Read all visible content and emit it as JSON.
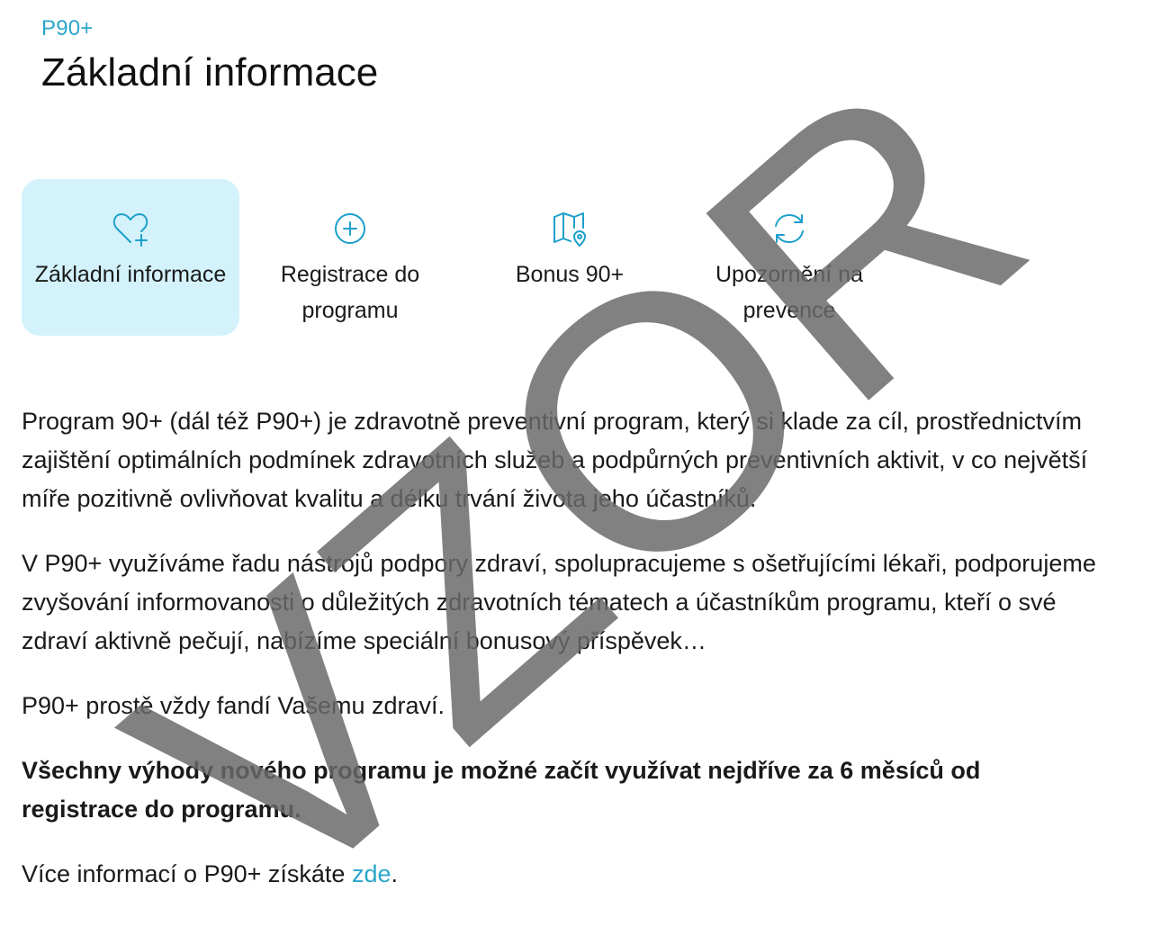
{
  "breadcrumb": "P90+",
  "page_title": "Základní informace",
  "tabs": [
    {
      "label": "Základní informace",
      "icon": "heart-plus-icon",
      "active": true
    },
    {
      "label": "Registrace do programu",
      "icon": "plus-circle-icon",
      "active": false
    },
    {
      "label": "Bonus 90+",
      "icon": "map-pin-icon",
      "active": false
    },
    {
      "label": "Upozornění na prevence",
      "icon": "refresh-icon",
      "active": false
    }
  ],
  "content": {
    "paragraph_1": "Program 90+ (dál též P90+) je zdravotně preventivní program, který si klade za cíl, prostřednictvím zajištění optimálních podmínek zdravotních služeb a podpůrných preventivních aktivit, v co největší míře pozitivně ovlivňovat kvalitu a délku trvání života jeho účastníků.",
    "paragraph_2": "V P90+ využíváme řadu nástrojů podpory zdraví, spolupracujeme s ošetřujícími lékaři, podporujeme zvyšování informovanosti o důležitých zdravotních tématech a účastníkům programu, kteří o své zdraví aktivně pečují, nabízíme speciální bonusový příspěvek…",
    "paragraph_3": "P90+ prostě vždy fandí Vašemu zdraví.",
    "paragraph_bold": "Všechny výhody nového programu je možné začít využívat nejdříve za 6 měsíců od registrace do programu.",
    "more_info_prefix": "Více informací o P90+ získáte ",
    "more_info_link": "zde",
    "more_info_suffix": "."
  },
  "watermark": "VZOR",
  "colors": {
    "accent": "#2aa6c9",
    "icon": "#1c9fcb",
    "active_tab_bg": "#d3f2fb",
    "watermark": "#696969"
  }
}
